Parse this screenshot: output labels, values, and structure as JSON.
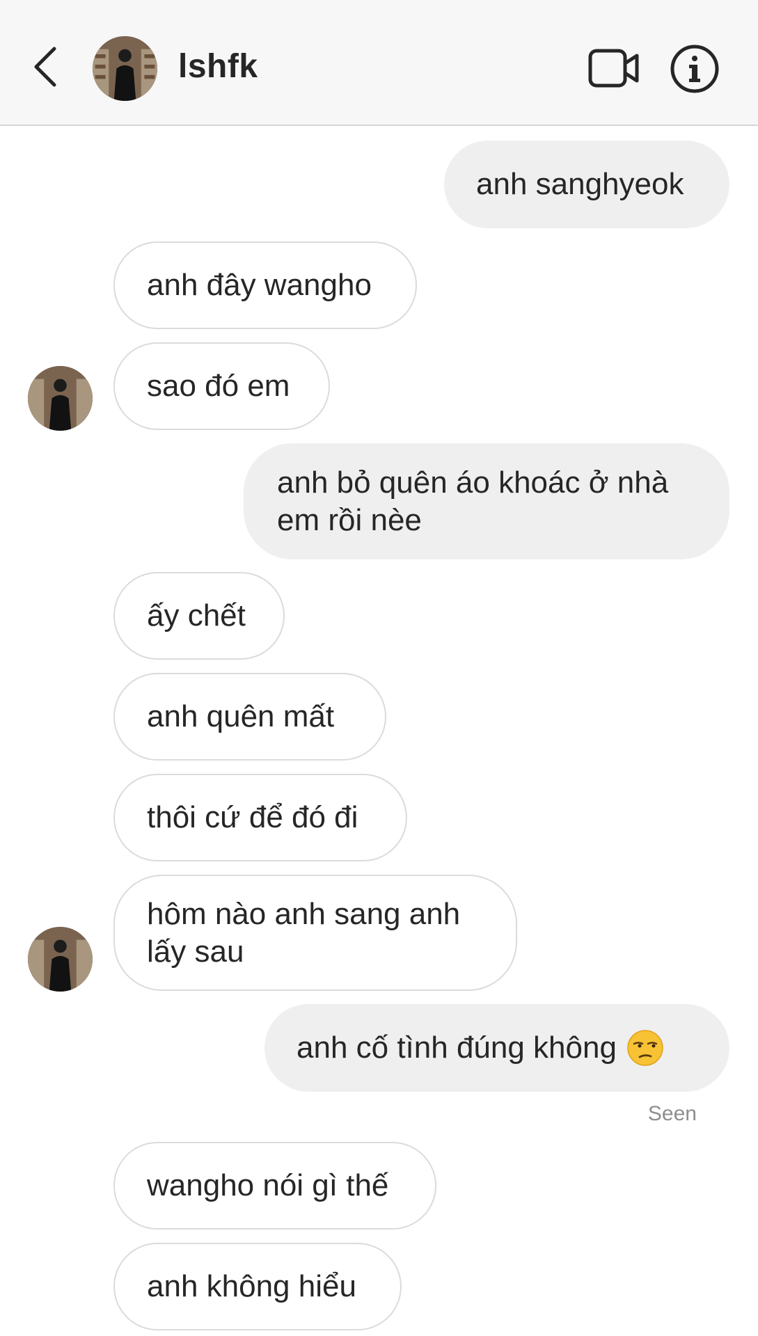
{
  "header": {
    "username": "lshfk"
  },
  "messages": [
    {
      "side": "sent",
      "text": "anh sanghyeok"
    },
    {
      "side": "recv",
      "text": "anh đây wangho"
    },
    {
      "side": "recv",
      "text": "sao đó em",
      "avatar": true
    },
    {
      "side": "sent",
      "text": "anh bỏ quên áo khoác ở nhà\nem rồi nèe"
    },
    {
      "side": "recv",
      "text": "ấy chết"
    },
    {
      "side": "recv",
      "text": "anh quên mất"
    },
    {
      "side": "recv",
      "text": "thôi cứ để đó đi"
    },
    {
      "side": "recv",
      "text": "hôm nào anh sang anh\nlấy sau",
      "avatar": true
    },
    {
      "side": "sent",
      "text": "anh cố tình đúng không",
      "emoji": "unamused-face"
    },
    {
      "side": "recv",
      "text": "wangho nói gì thế"
    },
    {
      "side": "recv",
      "text": "anh không hiểu"
    }
  ],
  "seen_label": "Seen",
  "icons": [
    "back-arrow-icon",
    "video-camera-icon",
    "info-icon"
  ],
  "colors": {
    "header_bg": "#f7f7f7",
    "sent_bubble": "#efefef",
    "recv_border": "#dbdbdb",
    "text": "#262626",
    "seen": "#8e8e8e"
  }
}
